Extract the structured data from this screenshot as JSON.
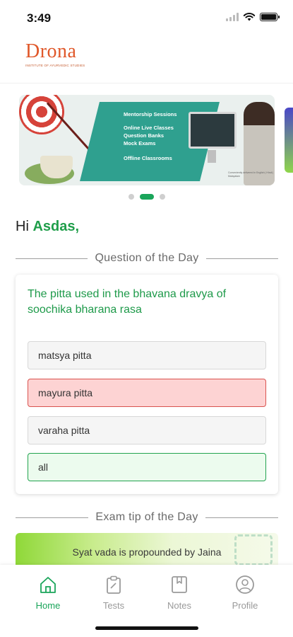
{
  "status_bar": {
    "time": "3:49"
  },
  "header": {
    "logo_text": "Drona",
    "logo_subtitle": "INSTITUTE OF AYURVEDIC STUDIES"
  },
  "carousel": {
    "banner_lines": [
      "Mentorship Sessions",
      "Online Live Classes",
      "Question Banks",
      "Mock Exams",
      "Offline Classrooms"
    ],
    "banner_footer": "Conveniently delivered in English | Hindi | Malayalam",
    "active_index": 1,
    "slide_count": 3
  },
  "greeting": {
    "prefix": "Hi",
    "name": "Asdas,"
  },
  "qotd": {
    "heading": "Question of the Day",
    "question": "The pitta used in the bhavana dravya of soochika bharana rasa",
    "options": [
      {
        "label": "matsya pitta",
        "state": "normal"
      },
      {
        "label": "mayura pitta",
        "state": "wrong"
      },
      {
        "label": "varaha pitta",
        "state": "normal"
      },
      {
        "label": "all",
        "state": "correct"
      }
    ]
  },
  "tip": {
    "heading": "Exam tip of the Day",
    "text": "Syat vada is propounded by Jaina"
  },
  "bottom_nav": {
    "items": [
      {
        "label": "Home",
        "icon": "home-icon",
        "active": true
      },
      {
        "label": "Tests",
        "icon": "clipboard-icon",
        "active": false
      },
      {
        "label": "Notes",
        "icon": "bookmark-icon",
        "active": false
      },
      {
        "label": "Profile",
        "icon": "profile-icon",
        "active": false
      }
    ]
  },
  "colors": {
    "brand_green": "#1aa55a",
    "logo_orange": "#e0582a",
    "wrong_red": "#d9534f"
  }
}
